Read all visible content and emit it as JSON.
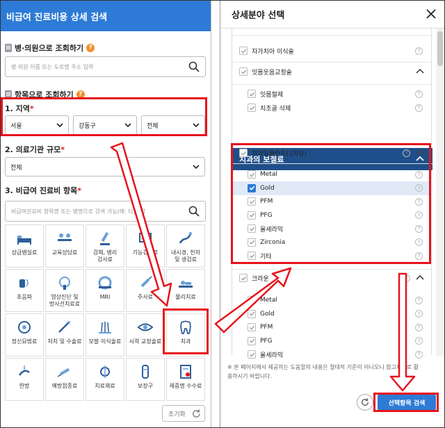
{
  "left": {
    "header_title": "비급여 진료비용 상세 검색",
    "hospital_section_title": "병·의원으로 조회하기",
    "hospital_search_placeholder": "병·의원 이름 또는 도로명 주소 입력",
    "item_section_title": "항목으로 조회하기",
    "region_label": "1. 지역",
    "region_selects": [
      "서울",
      "강동구",
      "전체"
    ],
    "size_label": "2. 의료기관 규모",
    "size_value": "전체",
    "treatment_label": "3. 비급여 진료비 항목",
    "treatment_search_placeholder": "비급여진료비 항목명 또는 병명으로 검색 가능(예: 다)도감",
    "required_mark": "*",
    "categories": [
      {
        "label": "상급병실료",
        "icon": "bed-icon"
      },
      {
        "label": "교육상담료",
        "icon": "consult-icon"
      },
      {
        "label": "검체, 병리\n검사료",
        "icon": "lab-icon"
      },
      {
        "label": "기능검사료",
        "icon": "function-test-icon"
      },
      {
        "label": "내시경, 천자\n및 생검료",
        "icon": "endoscope-icon"
      },
      {
        "label": "초음파",
        "icon": "ultrasound-icon"
      },
      {
        "label": "영상진단 및\n방사선치료료",
        "icon": "radiology-icon"
      },
      {
        "label": "MRI",
        "icon": "mri-icon"
      },
      {
        "label": "주사료",
        "icon": "injection-icon"
      },
      {
        "label": "물리치료",
        "icon": "physio-icon"
      },
      {
        "label": "정신요법료",
        "icon": "brain-icon"
      },
      {
        "label": "처치 및 수술료",
        "icon": "surgery-icon"
      },
      {
        "label": "모발 이식술료",
        "icon": "hair-icon"
      },
      {
        "label": "시력 교정술료",
        "icon": "eye-icon"
      },
      {
        "label": "치과",
        "icon": "tooth-icon"
      },
      {
        "label": "한방",
        "icon": "acupuncture-icon"
      },
      {
        "label": "예방접종료",
        "icon": "vaccine-icon"
      },
      {
        "label": "치료재료",
        "icon": "material-icon"
      },
      {
        "label": "보장구",
        "icon": "brace-icon"
      },
      {
        "label": "제증명 수수료",
        "icon": "certificate-icon"
      }
    ],
    "reset_label": "초기화"
  },
  "right": {
    "header_title": "상세분야 선택",
    "rows_top": [
      {
        "label": "자가치아 이식술",
        "checked": false
      },
      {
        "label": "잇몸웃음교정술",
        "checked": false,
        "group": true
      },
      {
        "label": "잇몸절제",
        "checked": false
      },
      {
        "label": "치조골 삭제",
        "checked": false
      }
    ],
    "category_title": "치과의 보철료",
    "implant_group": "치과임플란트(1치당)",
    "implant_items": [
      {
        "label": "Metal",
        "checked": false
      },
      {
        "label": "Gold",
        "checked": true
      },
      {
        "label": "PFM",
        "checked": false
      },
      {
        "label": "PFG",
        "checked": false
      },
      {
        "label": "올세라믹",
        "checked": false
      },
      {
        "label": "Zirconia",
        "checked": false
      },
      {
        "label": "기타",
        "checked": false
      }
    ],
    "crown_group": "크라운",
    "crown_items": [
      {
        "label": "Metal"
      },
      {
        "label": "Gold"
      },
      {
        "label": "PFM"
      },
      {
        "label": "PFG"
      },
      {
        "label": "올세라믹"
      }
    ],
    "qmark": "?",
    "note": "※ 본 페이지에서 제공하는 도움말의 내용은 절대적 기준이 아니오니 참고자료로 활용하시기 바랍니다.",
    "search_button": "선택항목 검색"
  },
  "colors": {
    "accent": "#2d7bd6",
    "highlight": "#e8121b",
    "category_bar": "#1f4f8a"
  }
}
